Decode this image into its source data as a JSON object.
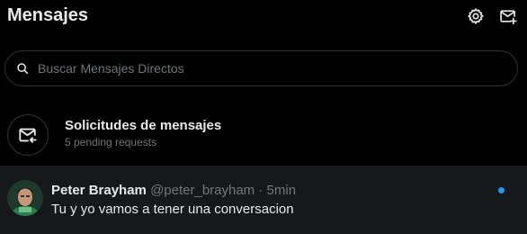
{
  "header": {
    "title": "Mensajes",
    "settings_icon": "gear-icon",
    "new_message_icon": "new-message-icon"
  },
  "search": {
    "placeholder": "Buscar Mensajes Directos",
    "value": "",
    "icon": "search-icon"
  },
  "requests": {
    "icon": "envelope-arrow-icon",
    "title": "Solicitudes de mensajes",
    "subtitle": "5 pending requests"
  },
  "conversations": [
    {
      "name": "Peter Brayham",
      "handle": "@peter_brayham",
      "separator": "·",
      "time": "5min",
      "message": "Tu y yo vamos a tener una conversacion",
      "unread": true
    }
  ],
  "colors": {
    "background": "#000000",
    "text": "#e7e9ea",
    "muted": "#71767b",
    "accent": "#1d9bf0",
    "border": "#2f3336",
    "selected_row": "#16181c"
  }
}
